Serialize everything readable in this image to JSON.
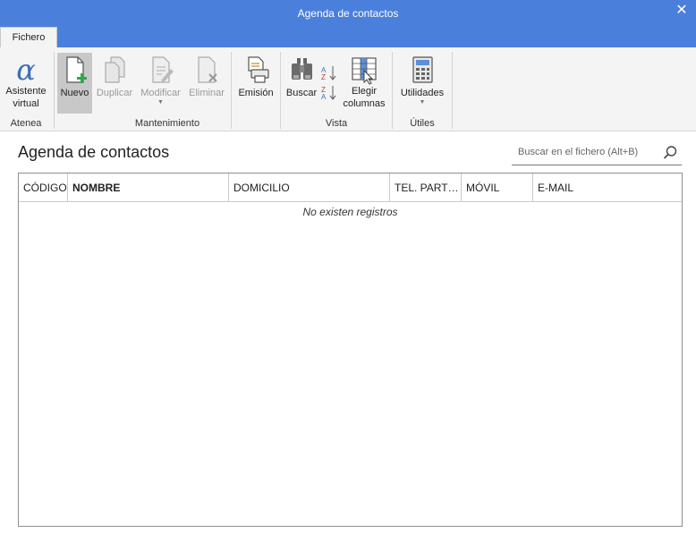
{
  "window": {
    "title": "Agenda de contactos",
    "close_glyph": "✕"
  },
  "tabs": {
    "fichero": "Fichero"
  },
  "ribbon": {
    "groups": {
      "atenea": "Atenea",
      "mantenimiento": "Mantenimiento",
      "vista": "Vista",
      "utiles": "Útiles"
    },
    "buttons": {
      "asistente_line1": "Asistente",
      "asistente_line2": "virtual",
      "nuevo": "Nuevo",
      "duplicar": "Duplicar",
      "modificar": "Modificar",
      "eliminar": "Eliminar",
      "emision": "Emisión",
      "buscar": "Buscar",
      "elegir_line1": "Elegir",
      "elegir_line2": "columnas",
      "utilidades": "Utilidades"
    },
    "icons": {
      "asistente": "alpha-icon",
      "nuevo": "new-document-icon",
      "duplicar": "duplicate-icon",
      "modificar": "edit-document-icon",
      "eliminar": "delete-document-icon",
      "emision": "print-icon",
      "buscar": "binoculars-icon",
      "sort": "sort-az-icon",
      "elegir": "choose-columns-icon",
      "utilidades": "calculator-icon"
    },
    "colors": {
      "accent": "#4a7fdc",
      "new_plus": "#2fa84f",
      "active_bg": "#c8c8c8"
    }
  },
  "main": {
    "title": "Agenda de contactos",
    "search_placeholder": "Buscar en el fichero (Alt+B)",
    "columns": [
      "CÓDIGO",
      "NOMBRE",
      "DOMICILIO",
      "TEL. PARTIC...",
      "MÓVIL",
      "E-MAIL"
    ],
    "empty_message": "No existen registros"
  }
}
